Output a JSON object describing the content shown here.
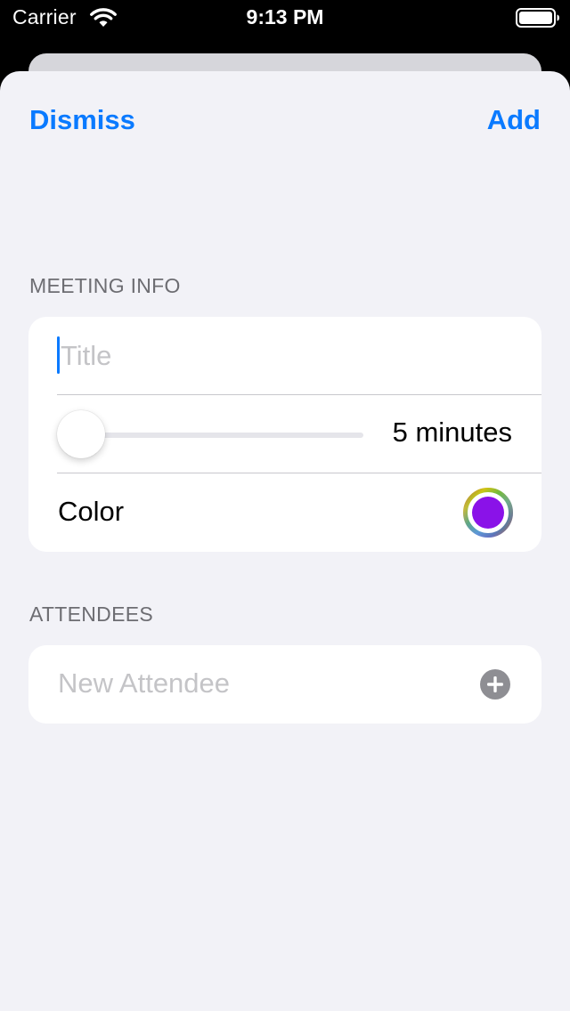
{
  "status_bar": {
    "carrier": "Carrier",
    "time": "9:13 PM"
  },
  "nav": {
    "dismiss_label": "Dismiss",
    "add_label": "Add"
  },
  "meeting_info": {
    "header": "MEETING INFO",
    "title_placeholder": "Title",
    "title_value": "",
    "length_minutes": 5,
    "length_min": 5,
    "length_max": 120,
    "length_label": "5 minutes",
    "color_label": "Color",
    "selected_color": "#8a12e8"
  },
  "attendees": {
    "header": "ATTENDEES",
    "new_placeholder": "New Attendee"
  },
  "icons": {
    "wifi": "wifi-icon",
    "battery": "battery-icon",
    "add": "plus-circle-icon",
    "color_well": "color-wheel-icon"
  },
  "colors": {
    "accent": "#0a7aff",
    "background": "#f2f2f7",
    "section_header": "#6d6d72",
    "placeholder": "#c4c4c7"
  }
}
